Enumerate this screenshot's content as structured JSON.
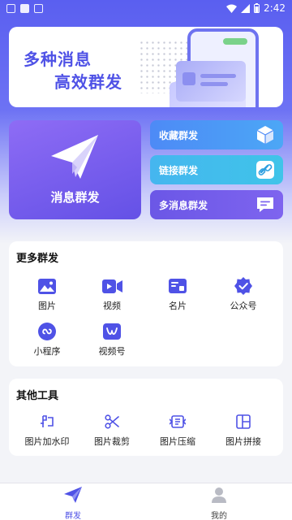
{
  "status_bar": {
    "time": "2:42"
  },
  "banner": {
    "line1": "多种消息",
    "line2": "高效群发"
  },
  "main_card": {
    "label": "消息群发"
  },
  "side_cards": [
    {
      "label": "收藏群发",
      "icon": "cube-icon"
    },
    {
      "label": "链接群发",
      "icon": "link-card-icon"
    },
    {
      "label": "多消息群发",
      "icon": "message-icon"
    }
  ],
  "more_section": {
    "title": "更多群发",
    "items": [
      {
        "label": "图片",
        "icon": "image-icon"
      },
      {
        "label": "视频",
        "icon": "video-icon"
      },
      {
        "label": "名片",
        "icon": "card-icon"
      },
      {
        "label": "公众号",
        "icon": "verified-icon"
      },
      {
        "label": "小程序",
        "icon": "mini-program-icon"
      },
      {
        "label": "视频号",
        "icon": "channels-icon"
      }
    ]
  },
  "tools_section": {
    "title": "其他工具",
    "items": [
      {
        "label": "图片加水印",
        "icon": "watermark-icon"
      },
      {
        "label": "图片裁剪",
        "icon": "scissors-icon"
      },
      {
        "label": "图片压缩",
        "icon": "compress-icon"
      },
      {
        "label": "图片拼接",
        "icon": "collage-icon"
      }
    ]
  },
  "bottom_nav": {
    "items": [
      {
        "label": "群发",
        "active": true
      },
      {
        "label": "我的",
        "active": false
      }
    ]
  },
  "colors": {
    "accent": "#4f52e6",
    "background": "#f3f4f8"
  }
}
